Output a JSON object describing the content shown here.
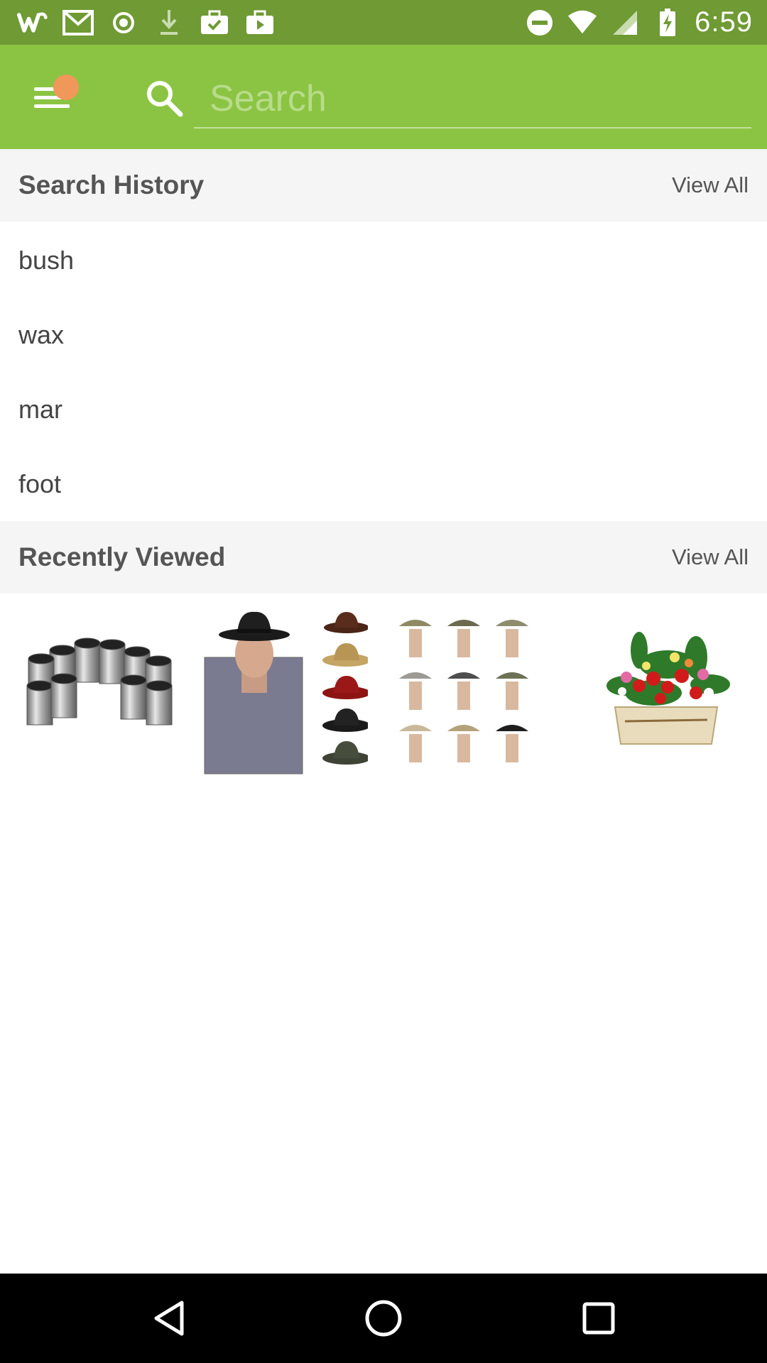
{
  "status_bar": {
    "time": "6:59",
    "left_icons": [
      "wish-logo-icon",
      "gmail-icon",
      "record-icon",
      "download-icon",
      "briefcase-check-icon",
      "briefcase-play-icon"
    ],
    "right_icons": [
      "do-not-disturb-icon",
      "wifi-icon",
      "cell-signal-icon",
      "battery-charging-icon"
    ]
  },
  "app_bar": {
    "search_placeholder": "Search",
    "accent": "#8bc443",
    "notification_dot_color": "#f0985a"
  },
  "search_history": {
    "title": "Search History",
    "view_all": "View All",
    "items": [
      "bush",
      "wax",
      "mar",
      "foot"
    ]
  },
  "recently_viewed": {
    "title": "Recently Viewed",
    "view_all": "View All",
    "items": [
      "linear-bearings-image",
      "fedora-hats-image",
      "bucket-hats-image",
      "flower-planter-image"
    ]
  },
  "nav_bar": {
    "icons": [
      "back-icon",
      "home-icon",
      "recents-icon"
    ]
  }
}
